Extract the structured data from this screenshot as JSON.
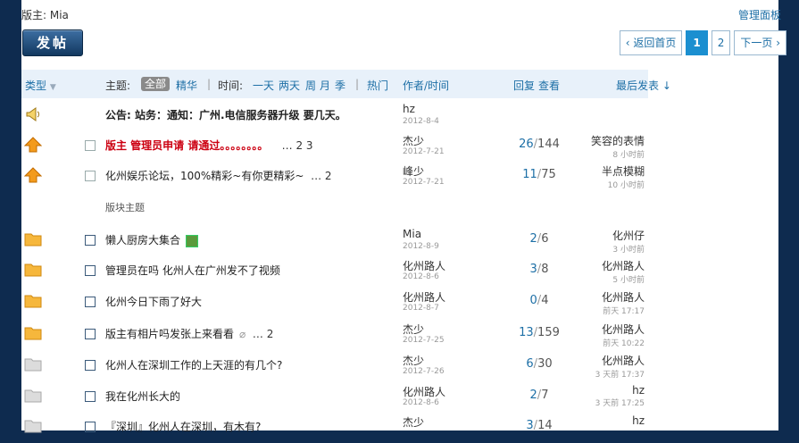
{
  "header": {
    "moderator_label": "版主: Mia",
    "admin_panel": "管理面板",
    "post_button": "发帖"
  },
  "pager": {
    "back_home": "返回首页",
    "pages": [
      "1",
      "2"
    ],
    "current": "1",
    "next": "下一页"
  },
  "thead": {
    "type": "类型",
    "topic_label": "主题:",
    "all": "全部",
    "digest": "精华",
    "time_label": "时间:",
    "day": "一天",
    "two_days": "两天",
    "week": "周",
    "month": "月",
    "season": "季",
    "hot": "热门",
    "author_time": "作者/时间",
    "reply": "回复",
    "view": "查看",
    "last_post": "最后发表"
  },
  "section_label": "版块主题",
  "announcement": {
    "prefix": "公告:",
    "title": "站务：通知：广州.电信服务器升级  要几天。",
    "author": "hz",
    "date": "2012-8-4"
  },
  "sticky": [
    {
      "title": "版主  管理员申请  请通过。。。。。。。。",
      "pages": "… 2  3",
      "author": "杰少",
      "date": "2012-7-21",
      "replies": "26",
      "views": "144",
      "last_user": "笑容的表情",
      "last_time": "8 小时前"
    },
    {
      "title": "化州娱乐论坛，100%精彩~有你更精彩~",
      "pages": "… 2",
      "author": "峰少",
      "date": "2012-7-21",
      "replies": "11",
      "views": "75",
      "last_user": "半点模糊",
      "last_time": "10 小时前"
    }
  ],
  "threads": [
    {
      "title": "懒人厨房大集合",
      "extra": "image",
      "pages": "",
      "author": "Mia",
      "date": "2012-8-9",
      "replies": "2",
      "views": "6",
      "last_user": "化州仔",
      "last_time": "3 小时前"
    },
    {
      "title": "管理员在吗  化州人在广州发不了视频",
      "extra": "",
      "pages": "",
      "author": "化州路人",
      "date": "2012-8-6",
      "replies": "3",
      "views": "8",
      "last_user": "化州路人",
      "last_time": "5 小时前"
    },
    {
      "title": "化州今日下雨了好大",
      "extra": "",
      "pages": "",
      "author": "化州路人",
      "date": "2012-8-7",
      "replies": "0",
      "views": "4",
      "last_user": "化州路人",
      "last_time": "前天 17:17"
    },
    {
      "title": "版主有相片吗发张上来看看",
      "extra": "clip",
      "pages": "… 2",
      "author": "杰少",
      "date": "2012-7-25",
      "replies": "13",
      "views": "159",
      "last_user": "化州路人",
      "last_time": "前天 10:22"
    },
    {
      "title": "化州人在深圳工作的上天涯的有几个?",
      "extra": "",
      "pages": "",
      "author": "杰少",
      "date": "2012-7-26",
      "replies": "6",
      "views": "30",
      "last_user": "化州路人",
      "last_time": "3 天前 17:37"
    },
    {
      "title": "我在化州长大的",
      "extra": "",
      "pages": "",
      "author": "化州路人",
      "date": "2012-8-6",
      "replies": "2",
      "views": "7",
      "last_user": "hz",
      "last_time": "3 天前 17:25"
    },
    {
      "title": "『深圳』化州人在深圳，有木有?",
      "extra": "",
      "pages": "",
      "author": "杰少",
      "date": "",
      "replies": "3",
      "views": "14",
      "last_user": "hz",
      "last_time": ""
    }
  ],
  "colors": {
    "accent": "#1d6fa6",
    "header_bg": "#e8f1fa",
    "hot_red": "#cc1111",
    "page_bg": "#0e2b4f"
  }
}
